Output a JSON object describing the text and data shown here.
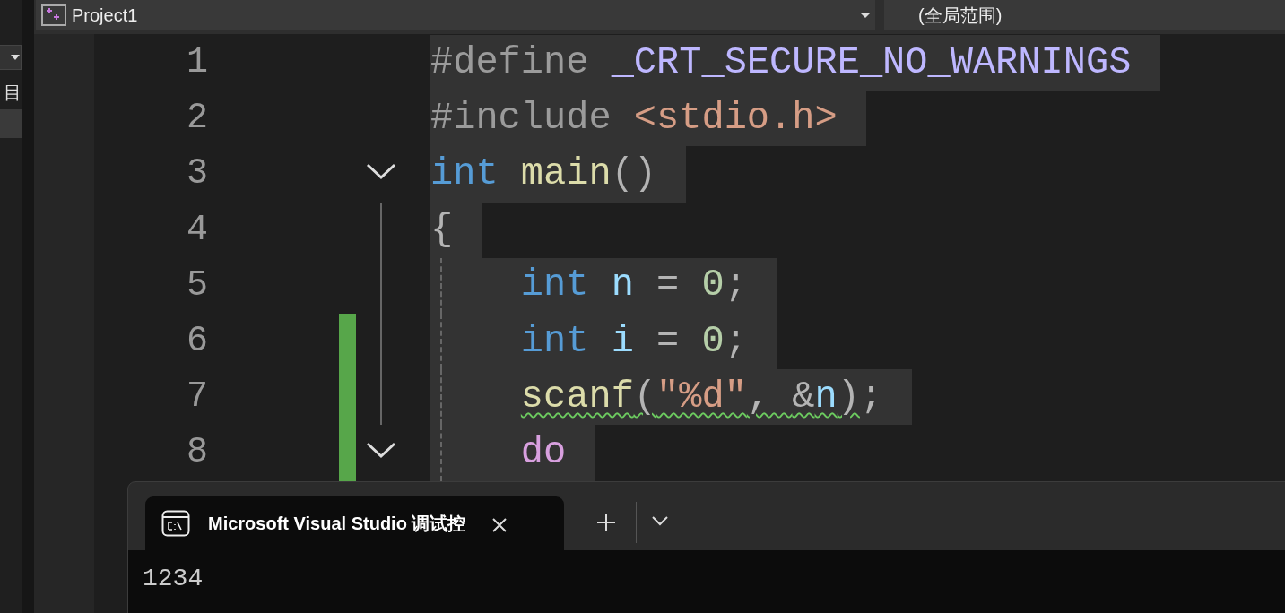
{
  "side_panel": {
    "label": "目"
  },
  "toolbar": {
    "project": "Project1",
    "scope": "(全局范围)"
  },
  "code_lines": [
    {
      "number": "1",
      "changed": false,
      "indent": false,
      "fold_marker": false,
      "in_fold": false,
      "tokens": [
        {
          "text": "#define",
          "kind": "pre"
        },
        {
          "text": " _CRT_SECURE_NO_WARNINGS",
          "kind": "macro"
        }
      ]
    },
    {
      "number": "2",
      "changed": false,
      "indent": false,
      "fold_marker": false,
      "in_fold": false,
      "tokens": [
        {
          "text": "#include",
          "kind": "pre"
        },
        {
          "text": " <stdio.h>",
          "kind": "string"
        }
      ]
    },
    {
      "number": "3",
      "changed": false,
      "indent": false,
      "fold_marker": true,
      "in_fold": false,
      "tokens": [
        {
          "text": "int",
          "kind": "keyword"
        },
        {
          "text": " main",
          "kind": "function"
        },
        {
          "text": "()",
          "kind": "punct"
        }
      ]
    },
    {
      "number": "4",
      "changed": false,
      "indent": false,
      "fold_marker": false,
      "in_fold": true,
      "tokens": [
        {
          "text": "{",
          "kind": "punct"
        }
      ]
    },
    {
      "number": "5",
      "changed": false,
      "indent": true,
      "fold_marker": false,
      "in_fold": true,
      "tokens": [
        {
          "text": "int",
          "kind": "keyword"
        },
        {
          "text": " n",
          "kind": "variable"
        },
        {
          "text": " = ",
          "kind": "punct"
        },
        {
          "text": "0",
          "kind": "number"
        },
        {
          "text": ";",
          "kind": "punct"
        }
      ]
    },
    {
      "number": "6",
      "changed": true,
      "indent": true,
      "fold_marker": false,
      "in_fold": true,
      "tokens": [
        {
          "text": "int",
          "kind": "keyword"
        },
        {
          "text": " i",
          "kind": "variable"
        },
        {
          "text": " = ",
          "kind": "punct"
        },
        {
          "text": "0",
          "kind": "number"
        },
        {
          "text": ";",
          "kind": "punct"
        }
      ]
    },
    {
      "number": "7",
      "changed": true,
      "indent": true,
      "fold_marker": false,
      "in_fold": true,
      "segments": [
        {
          "warning": true,
          "tokens": [
            {
              "text": "scanf",
              "kind": "function"
            },
            {
              "text": "(",
              "kind": "punct"
            },
            {
              "text": "\"%d\"",
              "kind": "string"
            },
            {
              "text": ", ",
              "kind": "punct"
            },
            {
              "text": "&",
              "kind": "punct"
            },
            {
              "text": "n",
              "kind": "variable"
            },
            {
              "text": ")",
              "kind": "punct"
            }
          ]
        },
        {
          "warning": false,
          "tokens": [
            {
              "text": ";",
              "kind": "punct"
            }
          ]
        }
      ]
    },
    {
      "number": "8",
      "changed": true,
      "indent": true,
      "fold_marker": true,
      "in_fold": true,
      "tokens": [
        {
          "text": "do",
          "kind": "control"
        }
      ]
    }
  ],
  "terminal": {
    "tab_title": "Microsoft Visual Studio 调试控",
    "output": [
      "1234"
    ]
  }
}
